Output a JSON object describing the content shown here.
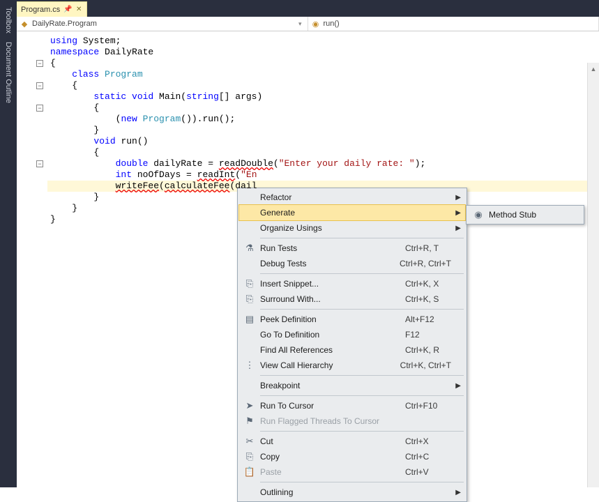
{
  "sidebar": {
    "tabs": [
      "Toolbox",
      "Document Outline"
    ]
  },
  "tab": {
    "filename": "Program.cs"
  },
  "nav": {
    "class": "DailyRate.Program",
    "method": "run()"
  },
  "code": {
    "lines": [
      {
        "indent": 0,
        "segs": [
          {
            "t": "using ",
            "c": "kw"
          },
          {
            "t": "System;"
          }
        ]
      },
      {
        "indent": 0,
        "segs": []
      },
      {
        "indent": 0,
        "segs": [
          {
            "t": "namespace ",
            "c": "kw"
          },
          {
            "t": "DailyRate"
          }
        ],
        "fold": true
      },
      {
        "indent": 0,
        "segs": [
          {
            "t": "{"
          }
        ]
      },
      {
        "indent": 1,
        "segs": [
          {
            "t": "class ",
            "c": "kw"
          },
          {
            "t": "Program",
            "c": "typ"
          }
        ],
        "fold": true
      },
      {
        "indent": 1,
        "segs": [
          {
            "t": "{"
          }
        ]
      },
      {
        "indent": 2,
        "segs": [
          {
            "t": "static ",
            "c": "kw"
          },
          {
            "t": "void ",
            "c": "kw"
          },
          {
            "t": "Main("
          },
          {
            "t": "string",
            "c": "kw"
          },
          {
            "t": "[] args)"
          }
        ],
        "fold": true
      },
      {
        "indent": 2,
        "segs": [
          {
            "t": "{"
          }
        ]
      },
      {
        "indent": 3,
        "segs": [
          {
            "t": "("
          },
          {
            "t": "new ",
            "c": "kw"
          },
          {
            "t": "Program",
            "c": "typ"
          },
          {
            "t": "()).run();"
          }
        ]
      },
      {
        "indent": 2,
        "segs": [
          {
            "t": "}"
          }
        ]
      },
      {
        "indent": 0,
        "segs": []
      },
      {
        "indent": 2,
        "segs": [
          {
            "t": "void ",
            "c": "kw"
          },
          {
            "t": "run()"
          }
        ],
        "fold": true
      },
      {
        "indent": 2,
        "segs": [
          {
            "t": "{"
          }
        ]
      },
      {
        "indent": 3,
        "segs": [
          {
            "t": "double ",
            "c": "kw"
          },
          {
            "t": "dailyRate = "
          },
          {
            "t": "readDouble",
            "c": "err"
          },
          {
            "t": "("
          },
          {
            "t": "\"Enter your daily rate: \"",
            "c": "str"
          },
          {
            "t": ");"
          }
        ],
        "hl": true
      },
      {
        "indent": 3,
        "segs": [
          {
            "t": "int ",
            "c": "kw"
          },
          {
            "t": "noOfDays = "
          },
          {
            "t": "readInt",
            "c": "err"
          },
          {
            "t": "("
          },
          {
            "t": "\"En",
            "c": "str"
          }
        ]
      },
      {
        "indent": 3,
        "segs": [
          {
            "t": "writeFee",
            "c": "err"
          },
          {
            "t": "("
          },
          {
            "t": "calculateFee",
            "c": "err"
          },
          {
            "t": "(dail"
          }
        ]
      },
      {
        "indent": 2,
        "segs": [
          {
            "t": "}"
          }
        ]
      },
      {
        "indent": 1,
        "segs": [
          {
            "t": "}"
          }
        ]
      },
      {
        "indent": 0,
        "segs": [
          {
            "t": "}"
          }
        ]
      }
    ]
  },
  "context_menu": {
    "items": [
      {
        "label": "Refactor",
        "submenu": true
      },
      {
        "label": "Generate",
        "submenu": true,
        "highlight": true
      },
      {
        "label": "Organize Usings",
        "submenu": true
      },
      {
        "sep": true
      },
      {
        "icon": "flask",
        "label": "Run Tests",
        "shortcut": "Ctrl+R, T"
      },
      {
        "label": "Debug Tests",
        "shortcut": "Ctrl+R, Ctrl+T"
      },
      {
        "sep": true
      },
      {
        "icon": "snippet",
        "label": "Insert Snippet...",
        "shortcut": "Ctrl+K, X"
      },
      {
        "icon": "surround",
        "label": "Surround With...",
        "shortcut": "Ctrl+K, S"
      },
      {
        "sep": true
      },
      {
        "icon": "peek",
        "label": "Peek Definition",
        "shortcut": "Alt+F12"
      },
      {
        "label": "Go To Definition",
        "shortcut": "F12"
      },
      {
        "label": "Find All References",
        "shortcut": "Ctrl+K, R"
      },
      {
        "icon": "hierarchy",
        "label": "View Call Hierarchy",
        "shortcut": "Ctrl+K, Ctrl+T"
      },
      {
        "sep": true
      },
      {
        "label": "Breakpoint",
        "submenu": true
      },
      {
        "sep": true
      },
      {
        "icon": "cursor",
        "label": "Run To Cursor",
        "shortcut": "Ctrl+F10"
      },
      {
        "icon": "flag",
        "label": "Run Flagged Threads To Cursor",
        "disabled": true
      },
      {
        "sep": true
      },
      {
        "icon": "cut",
        "label": "Cut",
        "shortcut": "Ctrl+X"
      },
      {
        "icon": "copy",
        "label": "Copy",
        "shortcut": "Ctrl+C"
      },
      {
        "icon": "paste",
        "label": "Paste",
        "shortcut": "Ctrl+V",
        "disabled": true
      },
      {
        "sep": true
      },
      {
        "label": "Outlining",
        "submenu": true
      }
    ],
    "generated_submenu": {
      "label": "Method Stub",
      "icon": "method"
    }
  }
}
